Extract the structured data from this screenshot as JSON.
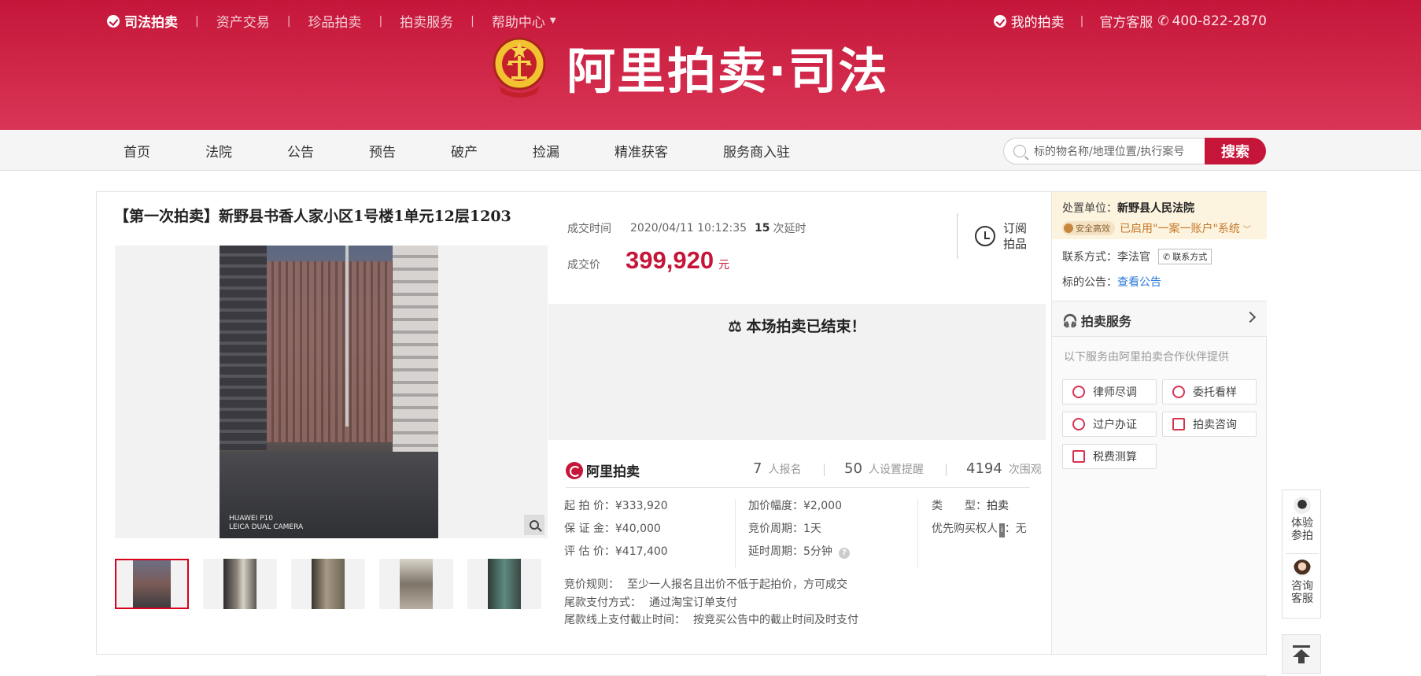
{
  "topnav": {
    "brand": "司法拍卖",
    "items": [
      "资产交易",
      "珍品拍卖",
      "拍卖服务",
      "帮助中心"
    ],
    "my_auction": "我的拍卖",
    "service_label": "官方客服",
    "phone": "400-822-2870"
  },
  "logo": {
    "text": "阿里拍卖·司法"
  },
  "nav": {
    "items": [
      "首页",
      "法院",
      "公告",
      "预告",
      "破产",
      "捡漏",
      "精准获客",
      "服务商入驻"
    ],
    "search_placeholder": "标的物名称/地理位置/执行案号",
    "search_button": "搜索"
  },
  "item": {
    "title": "【第一次拍卖】新野县书香人家小区1号楼1单元12层1203",
    "deal_time_label": "成交时间",
    "deal_time": "2020/04/11 10:12:35",
    "delay_count": "15",
    "delay_text": "次延时",
    "deal_price_label": "成交价",
    "deal_price": "399,920",
    "deal_price_unit": "元",
    "subscribe_line1": "订阅",
    "subscribe_line2": "拍品",
    "ended_message": "本场拍卖已结束！",
    "photo_watermark_1": "HUAWEI P10",
    "photo_watermark_2": "LEICA DUAL CAMERA",
    "thumbnail_count": 5
  },
  "stats": {
    "brand": "阿里拍卖",
    "signup_count": "7",
    "signup_label": "人报名",
    "reminder_count": "50",
    "reminder_label": "人设置提醒",
    "view_count": "4194",
    "view_label": "次围观"
  },
  "details": {
    "col1": [
      "起 拍 价：¥333,920",
      "保 证 金：¥40,000",
      "评 估 价：¥417,400"
    ],
    "col2": [
      "加价幅度：¥2,000",
      "竞价周期：1天",
      "延时周期：5分钟"
    ],
    "type_label": "类　　型：",
    "type_value": "拍卖",
    "priority_label": "优先购买权人",
    "priority_badge": "ⅰ",
    "priority_value": "：无"
  },
  "rules": [
    {
      "k": "竞价规则：",
      "v": "至少一人报名且出价不低于起拍价，方可成交"
    },
    {
      "k": "尾款支付方式：",
      "v": "通过淘宝订单支付"
    },
    {
      "k": "尾款线上支付截止时间：",
      "v": "按竞买公告中的截止时间及时支付"
    }
  ],
  "sidebar": {
    "unit_label": "处置单位：",
    "unit_value": "新野县人民法院",
    "safe_badge": "安全高效",
    "account_text": "已启用\"一案一账户\"系统",
    "contact_label": "联系方式：",
    "contact_name": "李法官",
    "contact_button": "联系方式",
    "notice_label": "标的公告：",
    "notice_link": "查看公告",
    "service_title": "拍卖服务",
    "service_note": "以下服务由阿里拍卖合作伙伴提供",
    "services": [
      "律师尽调",
      "委托看样",
      "过户办证",
      "拍卖咨询",
      "税费测算"
    ]
  },
  "float": {
    "experience_line1": "体验",
    "experience_line2": "参拍",
    "consult_line1": "咨询",
    "consult_line2": "客服"
  },
  "colors": {
    "brand_red": "#c5163a",
    "price_red": "#c5163a",
    "link_blue": "#2b7bd8"
  }
}
